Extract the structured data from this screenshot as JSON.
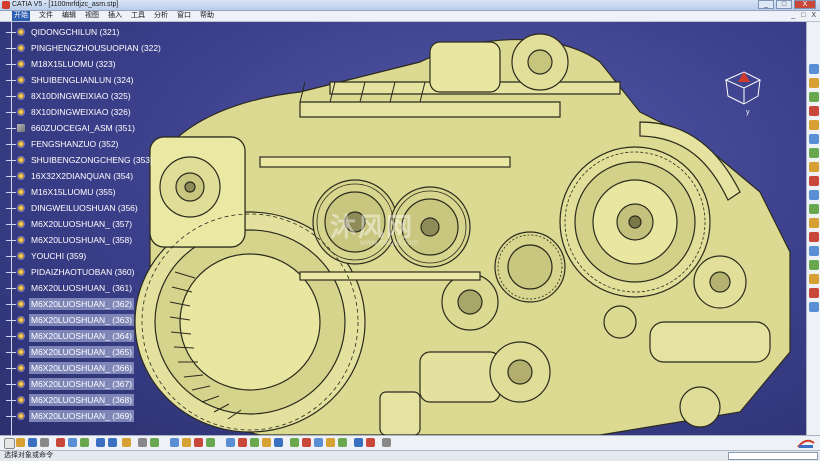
{
  "window": {
    "title": "CATIA V5 - [1100mrfdjzc_asm.stp]",
    "buttons": [
      "_",
      "□",
      "X"
    ]
  },
  "menu": {
    "items": [
      "开始",
      "文件",
      "编辑",
      "视图",
      "插入",
      "工具",
      "分析",
      "窗口",
      "帮助"
    ],
    "active_index": 0,
    "right": [
      "_",
      "□",
      "X"
    ]
  },
  "tree": {
    "items": [
      {
        "label": "QIDONGCHILUN (321)",
        "selected": false,
        "icon": "part-icon"
      },
      {
        "label": "PINGHENGZHOUSUOPIAN (322)",
        "selected": false,
        "icon": "part-icon"
      },
      {
        "label": "M18X15LUOMU (323)",
        "selected": false,
        "icon": "part-icon"
      },
      {
        "label": "SHUIBENGLIANLUN (324)",
        "selected": false,
        "icon": "part-icon"
      },
      {
        "label": "8X10DINGWEIXIAO (325)",
        "selected": false,
        "icon": "part-icon"
      },
      {
        "label": "8X10DINGWEIXIAO (326)",
        "selected": false,
        "icon": "part-icon"
      },
      {
        "label": "660ZUOCEGAI_ASM (351)",
        "selected": false,
        "icon": "assembly-icon"
      },
      {
        "label": "FENGSHANZUO (352)",
        "selected": false,
        "icon": "part-icon"
      },
      {
        "label": "SHUIBENGZONGCHENG (353)",
        "selected": false,
        "icon": "part-icon"
      },
      {
        "label": "16X32X2DIANQUAN (354)",
        "selected": false,
        "icon": "part-icon"
      },
      {
        "label": "M16X15LUOMU (355)",
        "selected": false,
        "icon": "part-icon"
      },
      {
        "label": "DINGWEILUOSHUAN (356)",
        "selected": false,
        "icon": "part-icon"
      },
      {
        "label": "M6X20LUOSHUAN_ (357)",
        "selected": false,
        "icon": "part-icon"
      },
      {
        "label": "M6X20LUOSHUAN_ (358)",
        "selected": false,
        "icon": "part-icon"
      },
      {
        "label": "YOUCHI (359)",
        "selected": false,
        "icon": "part-icon"
      },
      {
        "label": "PIDAIZHAOTUOBAN (360)",
        "selected": false,
        "icon": "part-icon"
      },
      {
        "label": "M6X20LUOSHUAN_ (361)",
        "selected": false,
        "icon": "part-icon"
      },
      {
        "label": "M6X20LUOSHUAN_ (362)",
        "selected": true,
        "icon": "part-icon"
      },
      {
        "label": "M6X20LUOSHUAN_ (363)",
        "selected": true,
        "icon": "part-icon"
      },
      {
        "label": "M6X20LUOSHUAN_ (364)",
        "selected": true,
        "icon": "part-icon"
      },
      {
        "label": "M6X20LUOSHUAN_ (365)",
        "selected": true,
        "icon": "part-icon"
      },
      {
        "label": "M6X20LUOSHUAN_ (366)",
        "selected": true,
        "icon": "part-icon"
      },
      {
        "label": "M6X20LUOSHUAN_ (367)",
        "selected": true,
        "icon": "part-icon"
      },
      {
        "label": "M6X20LUOSHUAN_ (368)",
        "selected": true,
        "icon": "part-icon"
      },
      {
        "label": "M6X20LUOSHUAN_ (369)",
        "selected": true,
        "icon": "part-icon"
      }
    ]
  },
  "watermark": {
    "text": "沐风网",
    "sub": "www.mfcad.com"
  },
  "compass": {
    "axis_y": "y",
    "icon": "compass-icon"
  },
  "right_toolbar": {
    "icons": [
      "select-icon",
      "fly-icon",
      "fit-all-icon",
      "pan-icon",
      "rotate-icon",
      "zoom-in-icon",
      "zoom-out-icon",
      "normal-view-icon",
      "iso-view-icon",
      "shading-icon",
      "hide-show-icon",
      "swap-icon",
      "material-icon",
      "sketch-icon",
      "measure-icon",
      "snapshot-icon",
      "render-icon",
      "section-icon"
    ]
  },
  "bottom_toolbar": {
    "icons": [
      "new-icon",
      "open-icon",
      "save-icon",
      "print-icon",
      "cut-icon",
      "copy-icon",
      "paste-icon",
      "undo-icon",
      "redo-icon",
      "help-icon",
      "fx-icon",
      "knowledge-icon",
      "table-icon",
      "box-icon",
      "axis-icon",
      "wireframe-icon",
      "mesh-icon",
      "clash-icon",
      "move-icon",
      "snap-icon",
      "explode-icon",
      "constraint-icon",
      "fix-icon",
      "contact-icon",
      "offset-icon",
      "angle-icon",
      "update-icon",
      "measure-icon",
      "analysis-icon",
      "product-icon",
      "component-icon",
      "replace-icon",
      "graph-icon",
      "bom-icon",
      "scene-icon",
      "publish-icon"
    ]
  },
  "status": {
    "text": "选择对象或命令",
    "input_placeholder": ""
  },
  "colors": {
    "background": "#3a3e86",
    "part": "#e8e6a0",
    "part_edge": "#2b2b1e",
    "selection": "#7e86b8"
  }
}
